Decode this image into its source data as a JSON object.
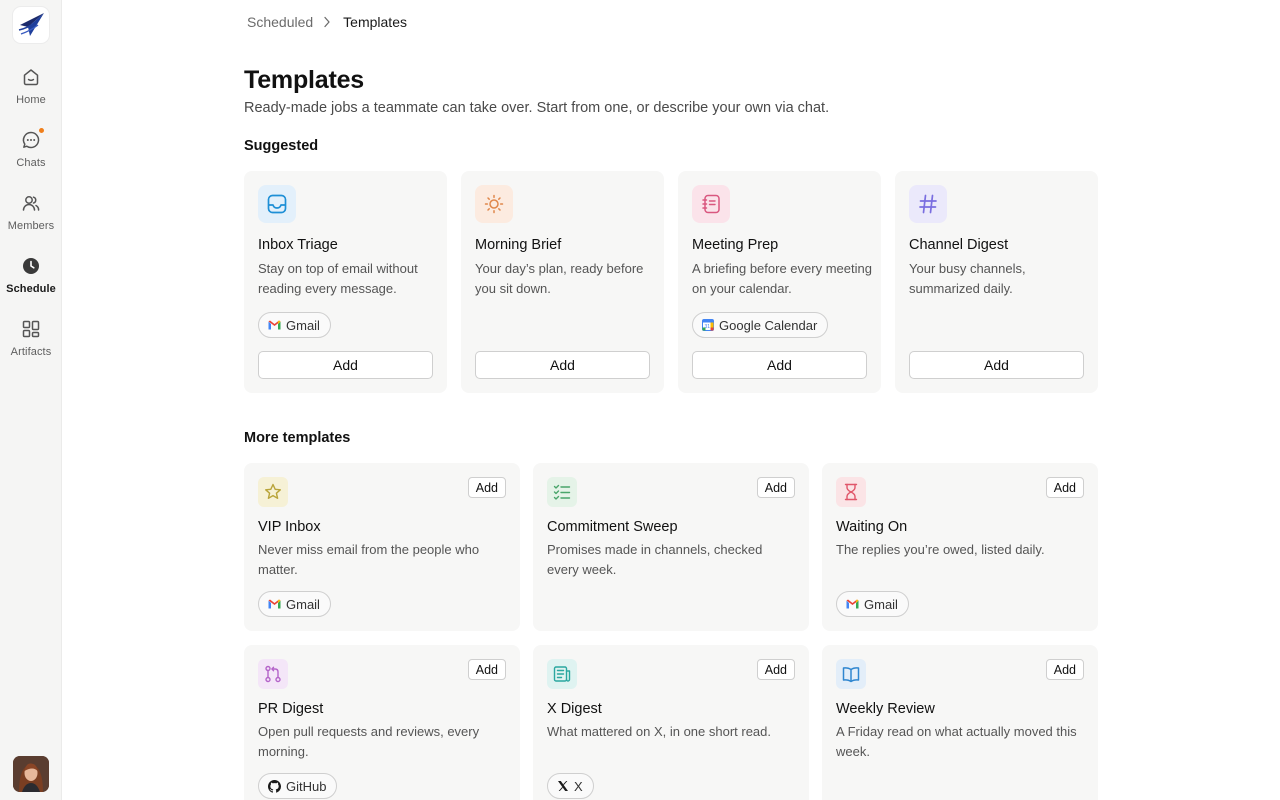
{
  "sidebar": {
    "items": [
      {
        "label": "Home",
        "icon": "home-icon"
      },
      {
        "label": "Chats",
        "icon": "chat-icon"
      },
      {
        "label": "Members",
        "icon": "members-icon"
      },
      {
        "label": "Schedule",
        "icon": "clock-icon"
      },
      {
        "label": "Artifacts",
        "icon": "artifacts-icon"
      }
    ],
    "active": "Schedule"
  },
  "breadcrumb": {
    "parent": "Scheduled",
    "current": "Templates"
  },
  "header": {
    "title": "Templates",
    "subtitle": "Ready-made jobs a teammate can take over. Start from one, or describe your own via chat."
  },
  "suggested": {
    "title": "Suggested",
    "cards": [
      {
        "title": "Inbox Triage",
        "description": "Stay on top of email without reading every message.",
        "chip": "Gmail",
        "button": "Add",
        "icon": "inbox-icon",
        "accent": "#1e8fd6",
        "tint": "#e3f0fb"
      },
      {
        "title": "Morning Brief",
        "description": "Your day’s plan, ready before you sit down.",
        "chip": "",
        "button": "Add",
        "icon": "sun-icon",
        "accent": "#e0874a",
        "tint": "#fcebe0"
      },
      {
        "title": "Meeting Prep",
        "description": "A briefing before every meeting on your calendar.",
        "chip": "Google Calendar",
        "button": "Add",
        "icon": "notebook-icon",
        "accent": "#d9577f",
        "tint": "#fbe3ea"
      },
      {
        "title": "Channel Digest",
        "description": "Your busy channels, summarized daily.",
        "chip": "",
        "button": "Add",
        "icon": "hash-icon",
        "accent": "#7a6ee0",
        "tint": "#ebe9fb"
      }
    ]
  },
  "more": {
    "title": "More templates",
    "cards": [
      {
        "title": "VIP Inbox",
        "description": "Never miss email from the people who matter.",
        "chip": "Gmail",
        "button": "Add",
        "icon": "star-icon",
        "accent": "#b9a43a",
        "tint": "#f6f1d6"
      },
      {
        "title": "Commitment Sweep",
        "description": "Promises made in channels, checked every week.",
        "chip": "",
        "button": "Add",
        "icon": "checklist-icon",
        "accent": "#4aa56b",
        "tint": "#e5f3e8"
      },
      {
        "title": "Waiting On",
        "description": "The replies you’re owed, listed daily.",
        "chip": "Gmail",
        "button": "Add",
        "icon": "hourglass-icon",
        "accent": "#e0566a",
        "tint": "#fbe4e6"
      },
      {
        "title": "PR Digest",
        "description": "Open pull requests and reviews, every morning.",
        "chip": "GitHub",
        "button": "Add",
        "icon": "git-pr-icon",
        "accent": "#b463c9",
        "tint": "#f4e6f8"
      },
      {
        "title": "X Digest",
        "description": "What mattered on X, in one short read.",
        "chip": "X",
        "button": "Add",
        "icon": "newspaper-icon",
        "accent": "#2aa7a0",
        "tint": "#dff3f1"
      },
      {
        "title": "Weekly Review",
        "description": "A Friday read on what actually moved this week.",
        "chip": "",
        "button": "Add",
        "icon": "book-icon",
        "accent": "#2f86d0",
        "tint": "#e3eef9"
      }
    ]
  }
}
